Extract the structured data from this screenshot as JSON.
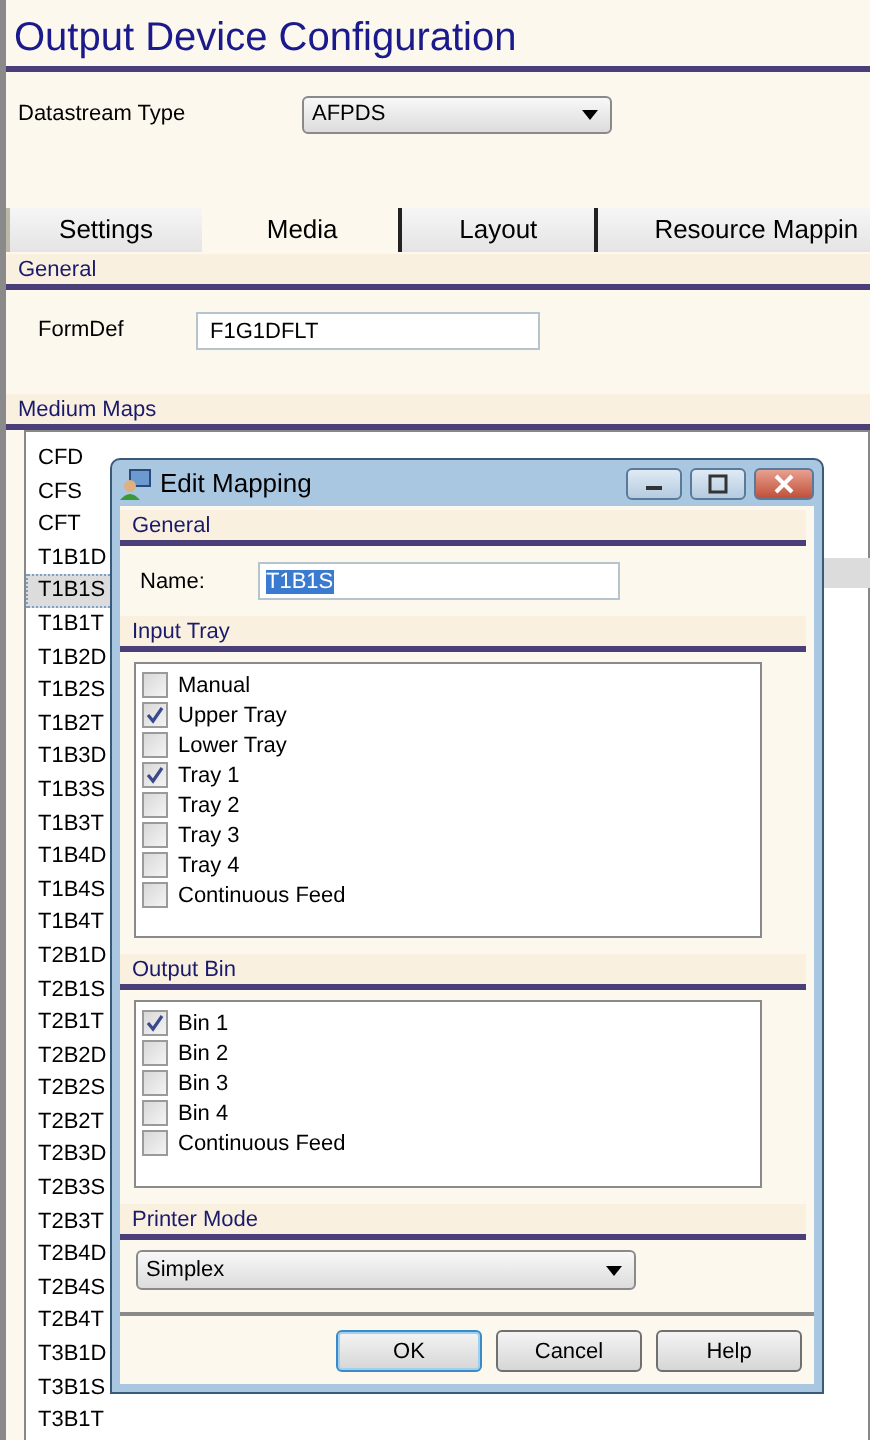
{
  "window": {
    "title": "Output Device Configuration"
  },
  "datastream": {
    "label": "Datastream Type",
    "value": "AFPDS"
  },
  "tabs": [
    {
      "label": "Settings",
      "selected": false
    },
    {
      "label": "Media",
      "selected": true
    },
    {
      "label": "Layout",
      "selected": false
    },
    {
      "label": "Resource Mappin",
      "selected": false
    }
  ],
  "general": {
    "heading": "General",
    "formdef_label": "FormDef",
    "formdef_value": "F1G1DFLT"
  },
  "medium_maps": {
    "heading": "Medium Maps",
    "items": [
      {
        "label": "CFD",
        "selected": false
      },
      {
        "label": "CFS",
        "selected": false
      },
      {
        "label": "CFT",
        "selected": false
      },
      {
        "label": "T1B1D",
        "selected": false
      },
      {
        "label": "T1B1S",
        "selected": true
      },
      {
        "label": "T1B1T",
        "selected": false
      },
      {
        "label": "T1B2D",
        "selected": false
      },
      {
        "label": "T1B2S",
        "selected": false
      },
      {
        "label": "T1B2T",
        "selected": false
      },
      {
        "label": "T1B3D",
        "selected": false
      },
      {
        "label": "T1B3S",
        "selected": false
      },
      {
        "label": "T1B3T",
        "selected": false
      },
      {
        "label": "T1B4D",
        "selected": false
      },
      {
        "label": "T1B4S",
        "selected": false
      },
      {
        "label": "T1B4T",
        "selected": false
      },
      {
        "label": "T2B1D",
        "selected": false
      },
      {
        "label": "T2B1S",
        "selected": false
      },
      {
        "label": "T2B1T",
        "selected": false
      },
      {
        "label": "T2B2D",
        "selected": false
      },
      {
        "label": "T2B2S",
        "selected": false
      },
      {
        "label": "T2B2T",
        "selected": false
      },
      {
        "label": "T2B3D",
        "selected": false
      },
      {
        "label": "T2B3S",
        "selected": false
      },
      {
        "label": "T2B3T",
        "selected": false
      },
      {
        "label": "T2B4D",
        "selected": false
      },
      {
        "label": "T2B4S",
        "selected": false
      },
      {
        "label": "T2B4T",
        "selected": false
      },
      {
        "label": "T3B1D",
        "selected": false
      },
      {
        "label": "T3B1S",
        "selected": false
      },
      {
        "label": "T3B1T",
        "selected": false
      }
    ]
  },
  "dialog": {
    "title": "Edit Mapping",
    "general_heading": "General",
    "name_label": "Name:",
    "name_value": "T1B1S",
    "input_tray": {
      "heading": "Input Tray",
      "items": [
        {
          "label": "Manual",
          "checked": false
        },
        {
          "label": "Upper Tray",
          "checked": true
        },
        {
          "label": "Lower Tray",
          "checked": false
        },
        {
          "label": "Tray 1",
          "checked": true
        },
        {
          "label": "Tray 2",
          "checked": false
        },
        {
          "label": "Tray 3",
          "checked": false
        },
        {
          "label": "Tray 4",
          "checked": false
        },
        {
          "label": "Continuous Feed",
          "checked": false
        }
      ]
    },
    "output_bin": {
      "heading": "Output Bin",
      "items": [
        {
          "label": "Bin 1",
          "checked": true
        },
        {
          "label": "Bin 2",
          "checked": false
        },
        {
          "label": "Bin 3",
          "checked": false
        },
        {
          "label": "Bin 4",
          "checked": false
        },
        {
          "label": "Continuous Feed",
          "checked": false
        }
      ]
    },
    "printer_mode": {
      "heading": "Printer Mode",
      "value": "Simplex"
    },
    "buttons": [
      {
        "label": "OK",
        "default": true
      },
      {
        "label": "Cancel",
        "default": false
      },
      {
        "label": "Help",
        "default": false
      }
    ]
  }
}
